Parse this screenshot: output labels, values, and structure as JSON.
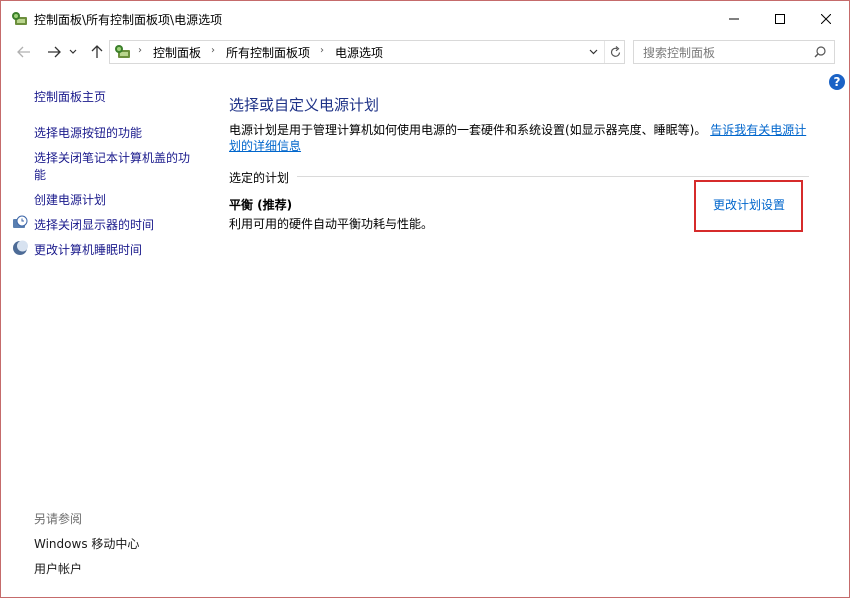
{
  "window": {
    "title": "控制面板\\所有控制面板项\\电源选项",
    "minimize_icon": "minimize-icon",
    "maximize_icon": "maximize-icon",
    "close_icon": "close-icon"
  },
  "nav": {
    "back_icon": "arrow-left-icon",
    "forward_icon": "arrow-right-icon",
    "recent_icon": "chevron-down-icon",
    "up_icon": "arrow-up-icon"
  },
  "address": {
    "breadcrumbs": [
      "控制面板",
      "所有控制面板项",
      "电源选项"
    ],
    "dropdown_icon": "chevron-down-icon",
    "refresh_icon": "refresh-icon"
  },
  "search": {
    "placeholder": "搜索控制面板",
    "icon": "search-icon"
  },
  "sidebar": {
    "home": "控制面板主页",
    "items": [
      {
        "label": "选择电源按钮的功能"
      },
      {
        "label": "选择关闭笔记本计算机盖的功能",
        "line1": "选择关闭笔记本计算机盖的功",
        "line2": "能"
      },
      {
        "label": "创建电源计划"
      },
      {
        "label": "选择关闭显示器的时间",
        "icon": "monitor-clock-icon"
      },
      {
        "label": "更改计算机睡眠时间",
        "icon": "moon-icon"
      }
    ],
    "see_also": "另请参阅",
    "see_also_links": [
      {
        "label": "Windows 移动中心"
      },
      {
        "label": "用户帐户"
      }
    ]
  },
  "main": {
    "title": "选择或自定义电源计划",
    "description": "电源计划是用于管理计算机如何使用电源的一套硬件和系统设置(如显示器亮度、睡眠等)。",
    "learn_more_part1": "告诉我有关电源计",
    "learn_more_part2": "划的详细信息",
    "section_label": "选定的计划",
    "plan_name": "平衡 (推荐)",
    "plan_description": "利用可用的硬件自动平衡功耗与性能。",
    "change_link": "更改计划设置",
    "help_icon": "help-icon",
    "help_glyph": "?"
  },
  "colors": {
    "title_blue": "#1e3287",
    "link_blue": "#0066cc",
    "highlight_red": "#d62b2b",
    "help_blue": "#1b63c6"
  }
}
